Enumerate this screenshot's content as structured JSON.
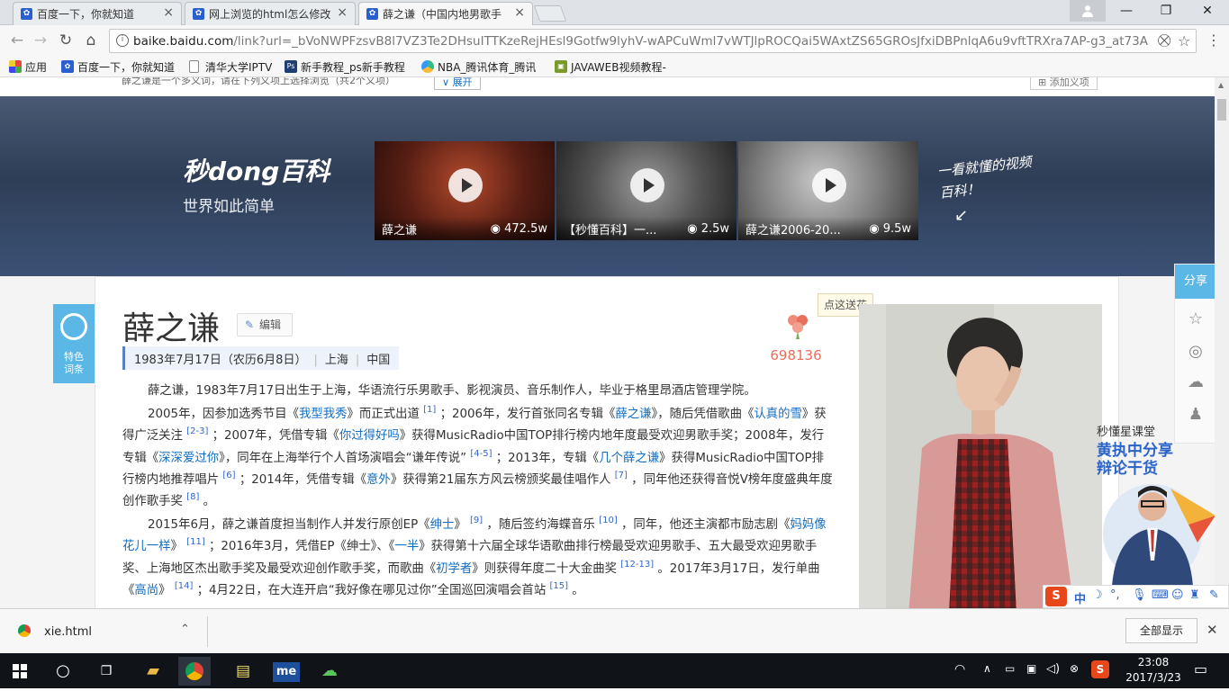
{
  "browser": {
    "tabs": [
      {
        "title": "百度一下，你就知道"
      },
      {
        "title": "网上浏览的html怎么修改"
      },
      {
        "title": "薛之谦（中国内地男歌手"
      }
    ],
    "url_host": "baike.baidu.com",
    "url_path": "/link?url=_bVoNWPFzsvB8l7VZ3Te2DHsuITTKzeRejHEsl9Gotfw9lyhV-wAPCuWml7vWTJlpROCQai5WAxtZS65GROsJfxiDBPnlqA6u9vftTRXra7AP-g3_at73A",
    "bookmarks": [
      {
        "label": "应用"
      },
      {
        "label": "百度一下，你就知道"
      },
      {
        "label": "清华大学IPTV"
      },
      {
        "label": "新手教程_ps新手教程"
      },
      {
        "label": "NBA_腾讯体育_腾讯"
      },
      {
        "label": "JAVAWEB视频教程-"
      }
    ]
  },
  "topstrip": {
    "text": "薛之谦是一个多义词，请在下列义项上选择浏览（共2个义项）",
    "expand": "展开",
    "add_sense": "添加义项"
  },
  "banner": {
    "logo": "秒dong百科",
    "slogan": "世界如此简单",
    "handwritten": "一看就懂的视频百科！",
    "videos": [
      {
        "caption": "薛之谦",
        "views": "472.5w"
      },
      {
        "caption": "【秒懂百科】一...",
        "views": "2.5w"
      },
      {
        "caption": "薛之谦2006-20...",
        "views": "9.5w"
      }
    ]
  },
  "sidetag": {
    "label_line1": "特色",
    "label_line2": "词条"
  },
  "entry": {
    "title": "薛之谦",
    "edit": "编辑",
    "birth": "1983年7月17日（农历6月8日）",
    "place": "上海",
    "country": "中国",
    "flower_tip": "点这送花",
    "flower_count": "698136"
  },
  "share": {
    "header": "分享"
  },
  "ad": {
    "brand": "秒懂星课堂",
    "line1": "黄执中分享",
    "line2": "辩论干货"
  },
  "ime": {
    "label": "中"
  },
  "download": {
    "file": "xie.html",
    "show_all": "全部显示"
  },
  "taskbar": {
    "time": "23:08",
    "date": "2017/3/23"
  }
}
